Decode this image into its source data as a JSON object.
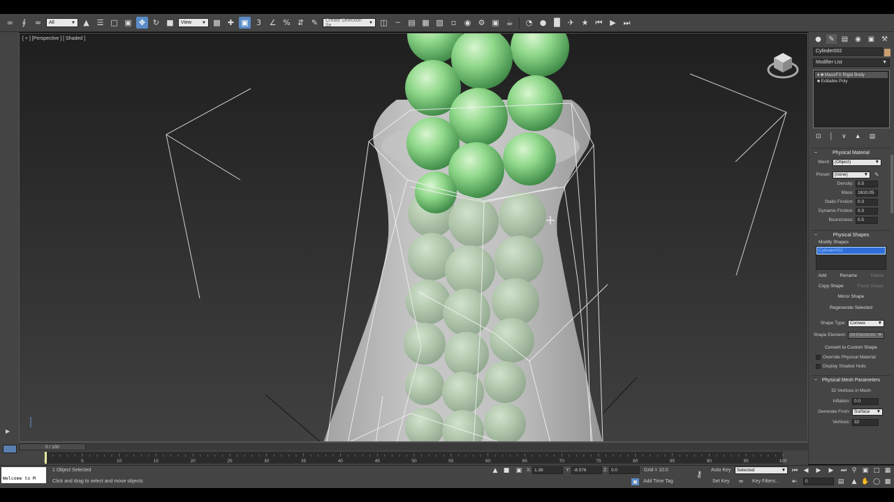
{
  "toolbar": {
    "selection_filter": "All",
    "reference_coord": "View",
    "named_selection_placeholder": "Create Selection Se"
  },
  "viewport": {
    "label": "[ + ] [Perspective ] [ Shaded ]"
  },
  "command_panel": {
    "object_name": "Cylinder002",
    "object_color": "#c8a070",
    "modifier_list_label": "Modifier List",
    "modifier_stack": [
      "MassFX Rigid Body",
      "Editable Poly"
    ],
    "physical_material": {
      "title": "Physical Material",
      "mesh_label": "Mesh:",
      "mesh_value": "(Object)",
      "preset_label": "Preset:",
      "preset_value": "(none)",
      "density_label": "Density:",
      "density_value": "0.5",
      "mass_label": "Mass:",
      "mass_value": "1610.05",
      "static_friction_label": "Static Friction:",
      "static_friction_value": "0.3",
      "dynamic_friction_label": "Dynamic Friction:",
      "dynamic_friction_value": "0.3",
      "bounciness_label": "Bounciness:",
      "bounciness_value": "0.5"
    },
    "physical_shapes": {
      "title": "Physical Shapes",
      "modify_shapes_label": "Modify Shapes",
      "shape_item": "Cylinder002",
      "add_label": "Add",
      "rename_label": "Rename",
      "delete_label": "Delete",
      "copy_shape_label": "Copy Shape",
      "paste_shape_label": "Paste Shape",
      "mirror_shape_label": "Mirror Shape",
      "regenerate_label": "Regenerate Selected",
      "shape_type_label": "Shape Type:",
      "shape_type_value": "Convex",
      "shape_element_label": "Shape Element:",
      "shape_element_value": "All Elements",
      "convert_label": "Convert to Custom Shape",
      "override_label": "Override Physical Material",
      "display_hulls_label": "Display Shaded Hulls"
    },
    "physical_mesh": {
      "title": "Physical Mesh Parameters",
      "vertices_info": "32 Vertices in Mesh",
      "inflation_label": "Inflation:",
      "inflation_value": "0.0",
      "generate_from_label": "Generate From:",
      "generate_from_value": "Surface",
      "vertices_label": "Vertices:",
      "vertices_value": "32"
    }
  },
  "time": {
    "slider_label": "0 / 100",
    "ticks": [
      "0",
      "5",
      "10",
      "15",
      "20",
      "25",
      "30",
      "35",
      "40",
      "45",
      "50",
      "55",
      "60",
      "65",
      "70",
      "75",
      "80",
      "85",
      "90",
      "95",
      "100"
    ]
  },
  "status": {
    "maxscript_text": "Welcome to M",
    "selected_text": "1 Object Selected",
    "prompt_text": "Click and drag to select and move objects",
    "x_label": "X:",
    "x_value": "1.38",
    "y_label": "Y:",
    "y_value": "-8.076",
    "z_label": "Z:",
    "z_value": "0.0",
    "grid_text": "Grid = 10.0",
    "add_time_tag": "Add Time Tag",
    "auto_key_label": "Auto Key",
    "auto_key_value": "Selected",
    "set_key_label": "Set Key",
    "key_filters_label": "Key Filters...",
    "frame_value": "0"
  }
}
